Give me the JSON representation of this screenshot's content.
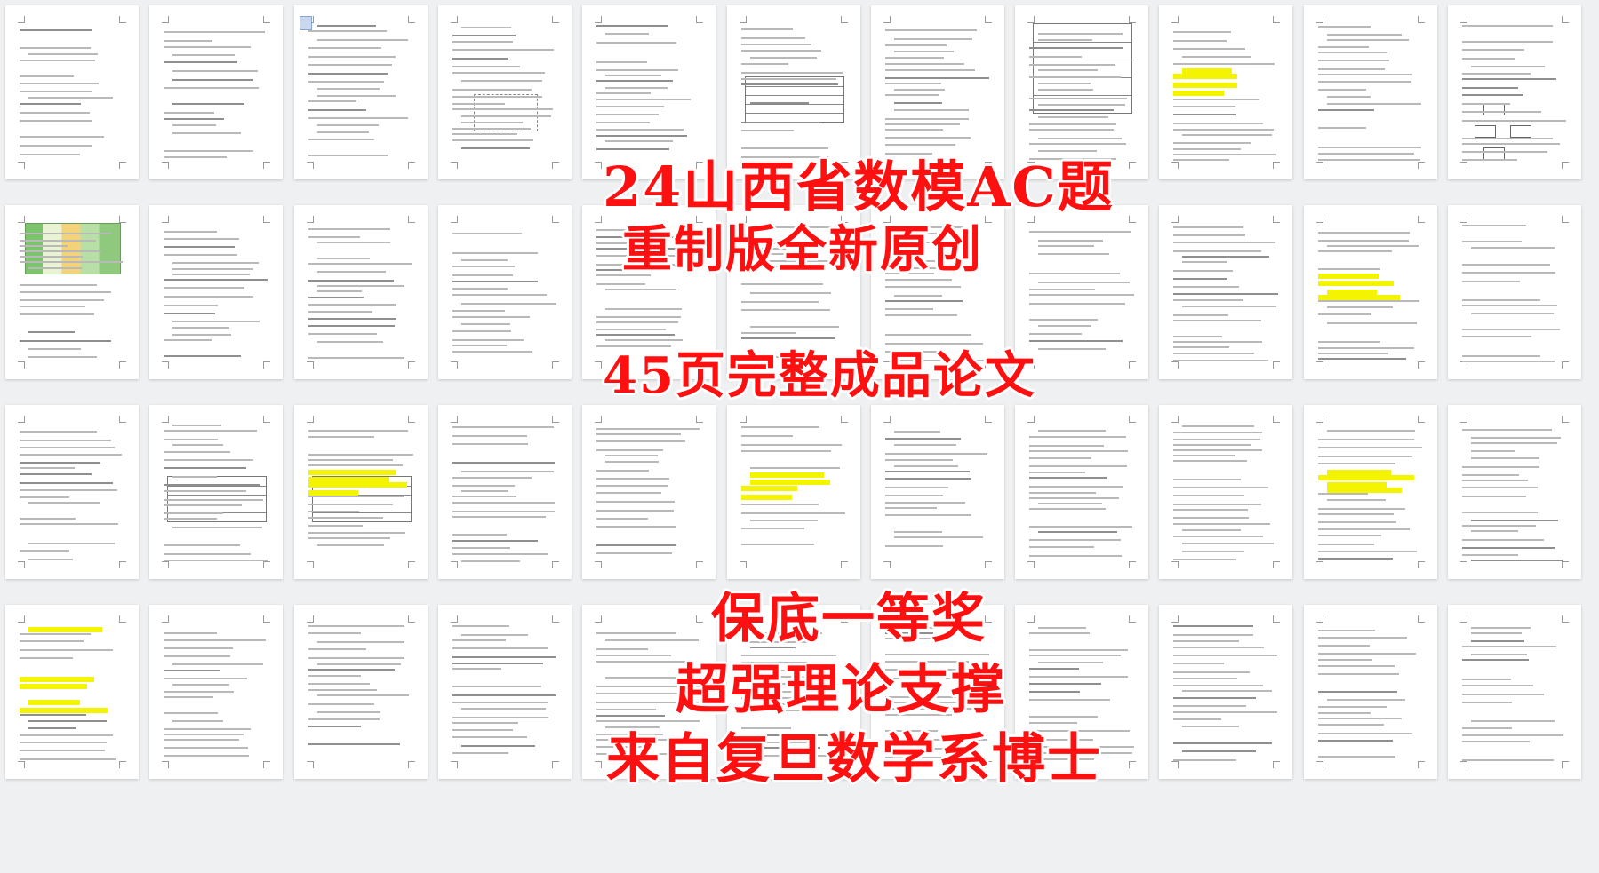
{
  "thumbnails": {
    "rows": 4,
    "cols": 11,
    "highlight_color": "#f4f400"
  },
  "overlay": {
    "color": "#ff1010",
    "line1": "24山西省数模AC题",
    "line2": "重制版全新原创",
    "line3": "45页完整成品论文",
    "line4": "保底一等奖",
    "line5": "超强理论支撑",
    "line6": "来自复旦数学系博士"
  }
}
